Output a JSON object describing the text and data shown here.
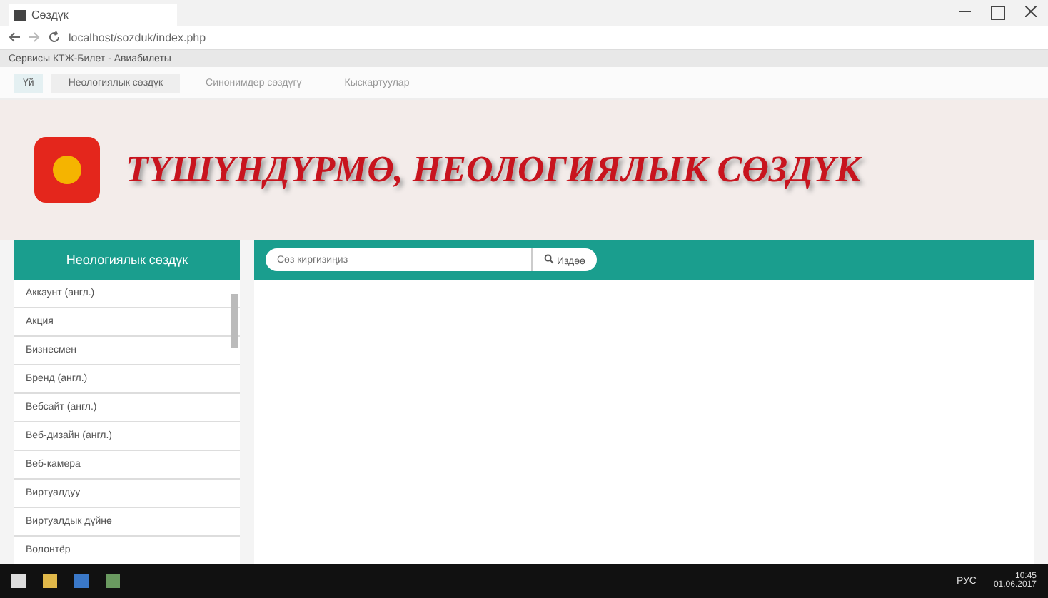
{
  "browser": {
    "tab_title": "Сөздүк",
    "address": "localhost/sozduk/index.php",
    "bookmarks": "Сервисы  КТЖ-Билет - Авиабилеты"
  },
  "nav": {
    "home": "Үй",
    "tabs": [
      {
        "label": "Неологиялык сөздүк",
        "selected": true
      },
      {
        "label": "Синонимдер сөздүгү",
        "selected": false
      },
      {
        "label": "Кыскартуулар",
        "selected": false
      }
    ]
  },
  "header": {
    "title": "ТҮШҮНДҮРМӨ, НЕОЛОГИЯЛЫК СӨЗДҮК"
  },
  "sidebar": {
    "heading": "Неологиялык сөздүк",
    "items": [
      {
        "label": "Аккаунт (англ.)"
      },
      {
        "label": "Акция"
      },
      {
        "label": "Бизнесмен"
      },
      {
        "label": "Бренд (англ.)"
      },
      {
        "label": "Вебсайт (англ.)"
      },
      {
        "label": "Веб-дизайн (англ.)"
      },
      {
        "label": "Веб-камера"
      },
      {
        "label": "Виртуалдуу"
      },
      {
        "label": "Виртуалдык дүйнө"
      },
      {
        "label": "Волонтёр"
      }
    ]
  },
  "search": {
    "placeholder": "Сөз киргизиңиз",
    "button": "Издөө"
  },
  "taskbar": {
    "language": "РУС",
    "time": "10:45",
    "date": "01.06.2017"
  }
}
